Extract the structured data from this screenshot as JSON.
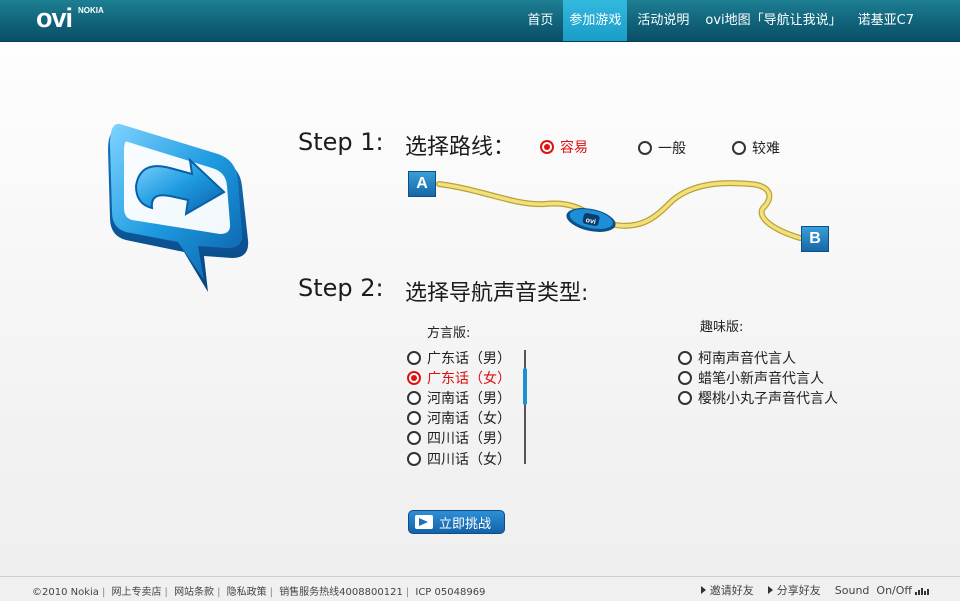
{
  "brand": {
    "logo_text": "ovi",
    "brand_text": "NOKIA"
  },
  "nav": {
    "items": [
      {
        "label": "首页"
      },
      {
        "label": "参加游戏",
        "active": true
      },
      {
        "label": "活动说明"
      },
      {
        "label": "ovi地图「导航让我说」"
      },
      {
        "label": "诺基亚C7"
      }
    ]
  },
  "step1": {
    "label": "Step 1:",
    "title": "选择路线：",
    "options": [
      {
        "label": "容易",
        "selected": true
      },
      {
        "label": "一般",
        "selected": false
      },
      {
        "label": "较难",
        "selected": false
      }
    ],
    "route": {
      "start": "A",
      "end": "B"
    }
  },
  "step2": {
    "label": "Step 2:",
    "title": "选择导航声音类型:",
    "dialect": {
      "label": "方言版:",
      "options": [
        {
          "label": "广东话（男）",
          "selected": false
        },
        {
          "label": "广东话（女）",
          "selected": true
        },
        {
          "label": "河南话（男）",
          "selected": false
        },
        {
          "label": "河南话（女）",
          "selected": false
        },
        {
          "label": "四川话（男）",
          "selected": false
        },
        {
          "label": "四川话（女）",
          "selected": false
        }
      ]
    },
    "fun": {
      "label": "趣味版:",
      "options": [
        {
          "label": "柯南声音代言人",
          "selected": false
        },
        {
          "label": "蜡笔小新声音代言人",
          "selected": false
        },
        {
          "label": "樱桃小丸子声音代言人",
          "selected": false
        }
      ]
    }
  },
  "challenge_button": {
    "label": "立即挑战"
  },
  "footer": {
    "links": [
      "©2010 Nokia",
      "网上专卖店",
      "网站条款",
      "隐私政策",
      "销售服务热线4008800121",
      "ICP 05048969"
    ],
    "invite": "邀请好友",
    "share": "分享好友",
    "sound": "Sound  On/Off"
  },
  "colors": {
    "topbar": "#10627a",
    "active_nav": "#22a8d4",
    "selected": "#dd1111",
    "button": "#1a73bd"
  }
}
